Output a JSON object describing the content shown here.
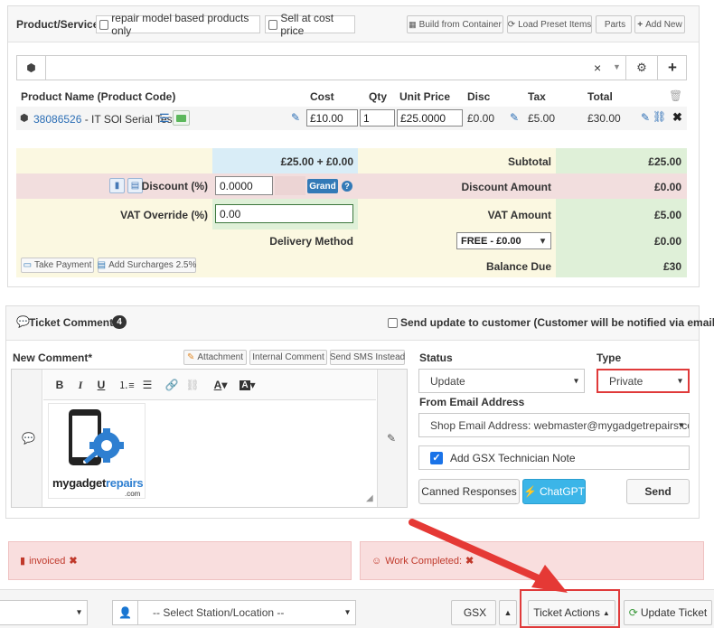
{
  "product_header": {
    "title": "Product/Service",
    "repair_model_label": "repair model based products only",
    "cost_price_label": "Sell at cost price",
    "build_container": "Build from Container",
    "load_preset": "Load Preset Items",
    "parts": "Parts",
    "add_new": "Add New"
  },
  "search": {
    "clear": "×"
  },
  "table": {
    "columns": [
      "Product Name (Product Code)",
      "Cost",
      "Qty",
      "Unit Price",
      "Disc",
      "Tax",
      "Total"
    ],
    "row": {
      "code": "38086526",
      "name": " - IT SOl Serial Test",
      "cost": "£10.00",
      "qty": "1",
      "unit_price": "£25.0000",
      "disc": "£0.00",
      "tax": "£5.00",
      "total": "£30.00"
    }
  },
  "summary": {
    "subtotal_formula": "£25.00 + £0.00",
    "subtotal_label": "Subtotal",
    "subtotal_value": "£25.00",
    "discount_label": "Discount (%)",
    "discount_value": "0.0000",
    "grand_label": "Grand",
    "discount_amount_label": "Discount Amount",
    "discount_amount_value": "£0.00",
    "vat_override_label": "VAT Override (%)",
    "vat_override_value": "0.00",
    "vat_amount_label": "VAT Amount",
    "vat_amount_value": "£5.00",
    "delivery_label": "Delivery Method",
    "delivery_option": "FREE - £0.00",
    "delivery_value": "£0.00",
    "take_payment": "Take Payment",
    "add_surcharges": "Add Surcharges 2.5%",
    "balance_label": "Balance Due",
    "balance_value": "£30"
  },
  "comments": {
    "title": "Ticket Comments",
    "count": "4",
    "send_update_label": "Send update to customer (Customer will be notified via email)",
    "new_comment_label": "New Comment*",
    "attachment": "Attachment",
    "internal_comment": "Internal Comment",
    "send_sms": "Send SMS Instead",
    "logo_text_a": "mygadget",
    "logo_text_b": "repairs",
    "logo_text_c": ".com",
    "status_label": "Status",
    "status_value": "Update",
    "type_label": "Type",
    "type_value": "Private",
    "from_email_label": "From Email Address",
    "from_email_value": "Shop Email Address: webmaster@mygadgetrepairs.co",
    "gsx_note": "Add GSX Technician Note",
    "canned": "Canned Responses",
    "chatgpt": "ChatGPT",
    "send": "Send"
  },
  "alerts": {
    "invoiced": "invoiced",
    "work_completed": "Work Completed:"
  },
  "footer": {
    "station_placeholder": "-- Select Station/Location --",
    "gsx": "GSX",
    "ticket_actions": "Ticket Actions",
    "update_ticket": "Update Ticket"
  },
  "colors": {
    "accent_blue": "#337ab7",
    "chatgpt": "#3bb5e8",
    "highlight_red": "#e03a3a",
    "yellow_bg": "#fbf8e1",
    "green_bg": "#dff0d8",
    "pink_bg": "#f2dede",
    "blue_bg": "#d9edf7"
  }
}
